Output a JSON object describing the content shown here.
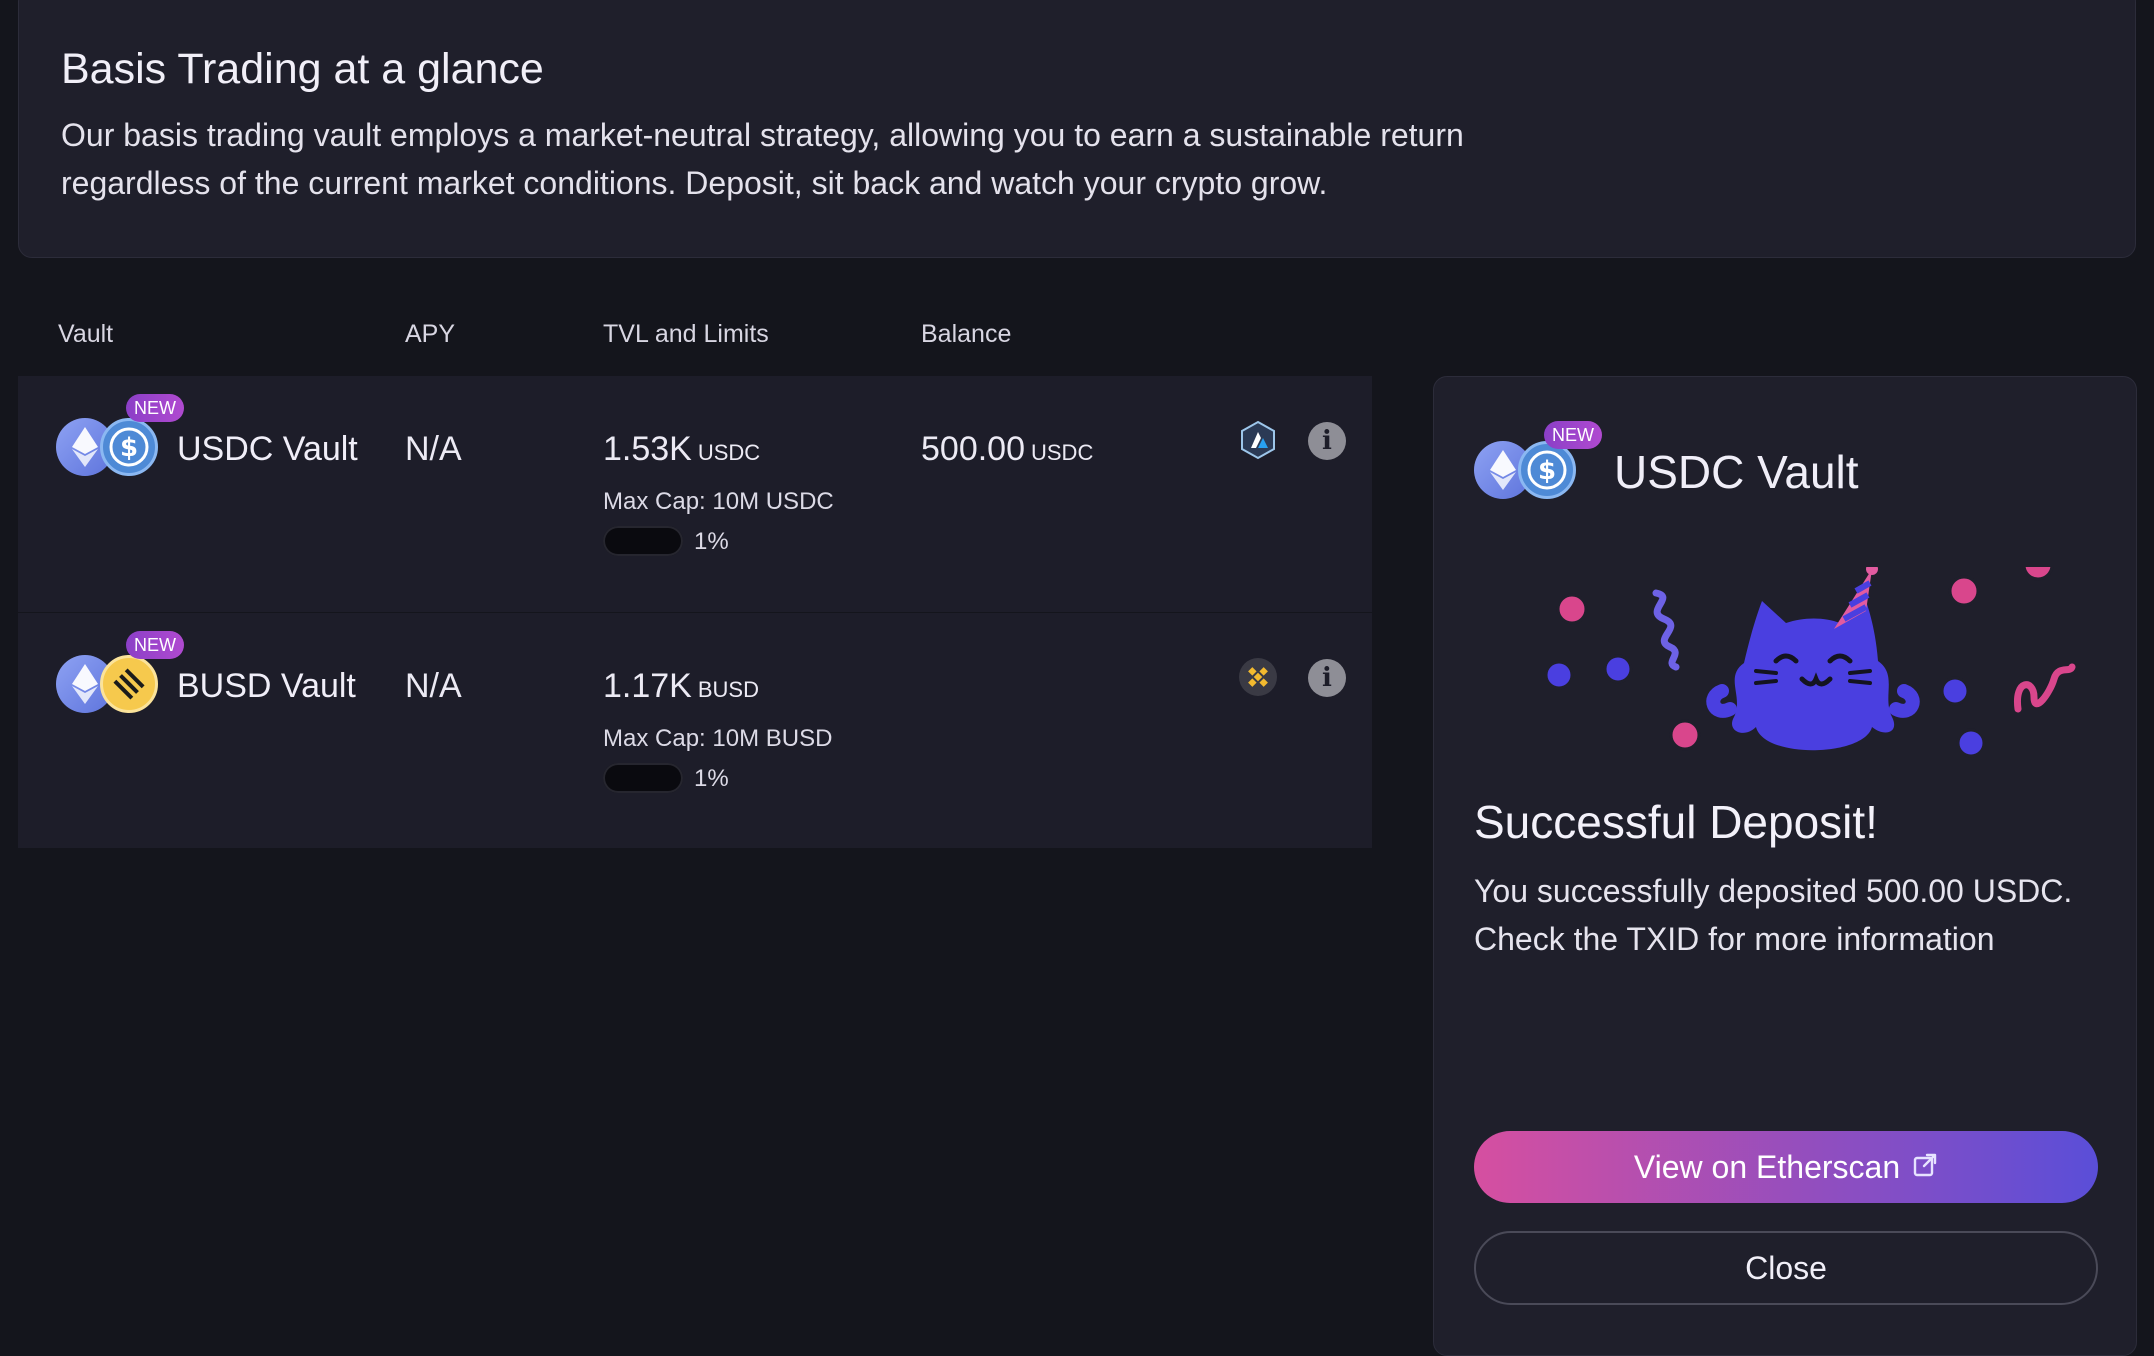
{
  "intro": {
    "title": "Basis Trading at a glance",
    "description": "Our basis trading vault employs a market-neutral strategy, allowing you to earn a sustainable return regardless of the current market conditions. Deposit, sit back and watch your crypto grow."
  },
  "table": {
    "headers": {
      "vault": "Vault",
      "apy": "APY",
      "tvl": "TVL and Limits",
      "balance": "Balance"
    },
    "rows": [
      {
        "badge": "NEW",
        "name": "USDC Vault",
        "apy": "N/A",
        "tvl_value": "1.53K",
        "tvl_unit": "USDC",
        "max_cap": "Max Cap: 10M USDC",
        "progress_label": "1%",
        "progress_value": 0.01,
        "balance_value": "500.00",
        "balance_unit": "USDC",
        "chain_icon": "arbitrum-icon",
        "info_icon": "info-icon"
      },
      {
        "badge": "NEW",
        "name": "BUSD Vault",
        "apy": "N/A",
        "tvl_value": "1.17K",
        "tvl_unit": "BUSD",
        "max_cap": "Max Cap: 10M BUSD",
        "progress_label": "1%",
        "progress_value": 0.01,
        "balance_value": "",
        "balance_unit": "",
        "chain_icon": "bnb-chain-icon",
        "info_icon": "info-icon"
      }
    ]
  },
  "panel": {
    "badge": "NEW",
    "title": "USDC Vault",
    "success_title": "Successful Deposit!",
    "success_message": "You successfully deposited 500.00 USDC. Check the TXID for more information",
    "primary_button": "View on Etherscan",
    "primary_button_icon": "external-link-icon",
    "secondary_button": "Close"
  },
  "colors": {
    "background": "#14151c",
    "card": "#1f1f2b",
    "badge": "#a044cc",
    "gradient_start": "#d64fa0",
    "gradient_end": "#5a4ed8",
    "confetti_pink": "#d9468c",
    "confetti_blue": "#4a3fe0"
  }
}
